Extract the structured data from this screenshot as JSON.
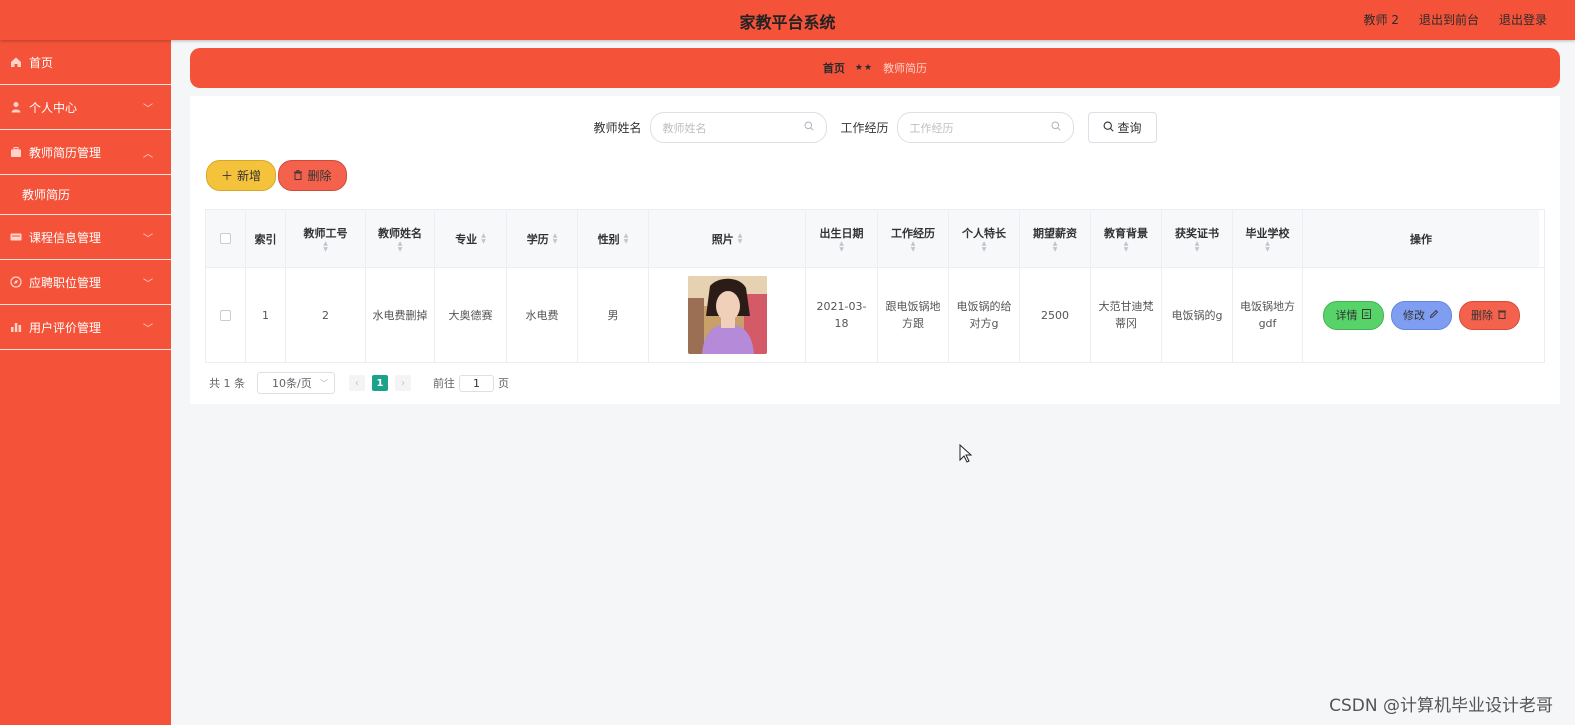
{
  "header": {
    "title": "家教平台系统",
    "user": "教师 2",
    "to_front": "退出到前台",
    "logout": "退出登录"
  },
  "sidebar": {
    "items": [
      {
        "label": "首页",
        "icon": "home-icon"
      },
      {
        "label": "个人中心",
        "icon": "user-icon"
      },
      {
        "label": "教师简历管理",
        "icon": "briefcase-icon"
      },
      {
        "label": "课程信息管理",
        "icon": "card-icon"
      },
      {
        "label": "应聘职位管理",
        "icon": "compass-icon"
      },
      {
        "label": "用户评价管理",
        "icon": "bar-chart-icon"
      }
    ],
    "subitem": "教师简历"
  },
  "breadcrumb": {
    "home": "首页",
    "separator": "★★",
    "current": "教师简历"
  },
  "search": {
    "name_label": "教师姓名",
    "name_placeholder": "教师姓名",
    "exp_label": "工作经历",
    "exp_placeholder": "工作经历",
    "button": "查询"
  },
  "actions": {
    "add": "新增",
    "delete": "删除"
  },
  "table": {
    "headers": [
      "索引",
      "教师工号",
      "教师姓名",
      "专业",
      "学历",
      "性别",
      "照片",
      "出生日期",
      "工作经历",
      "个人特长",
      "期望薪资",
      "教育背景",
      "获奖证书",
      "毕业学校",
      "操作"
    ],
    "row": {
      "index": "1",
      "teacher_no": "2",
      "name": "水电费删掉",
      "major": "大奥德赛",
      "education": "水电费",
      "gender": "男",
      "birth": "2021-03-18",
      "experience": "跟电饭锅地方跟",
      "specialty": "电饭锅的给对方g",
      "salary": "2500",
      "background": "大范甘迪梵蒂冈",
      "award": "电饭锅的g",
      "school": "电饭锅地方gdf"
    },
    "row_actions": {
      "detail": "详情",
      "edit": "修改",
      "remove": "删除"
    }
  },
  "pagination": {
    "total": "共 1 条",
    "page_size": "10条/页",
    "current_page": "1",
    "goto_prefix": "前往",
    "goto_value": "1",
    "goto_suffix": "页"
  },
  "watermark": "CSDN @计算机毕业设计老哥",
  "colors": {
    "primary": "#f4533a",
    "add": "#f5c33b",
    "detail": "#57d36a",
    "edit": "#7f9ef1",
    "remove": "#f4624e",
    "active_page": "#1aa38a"
  }
}
